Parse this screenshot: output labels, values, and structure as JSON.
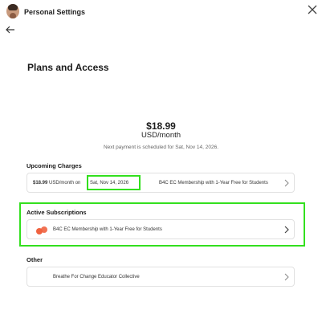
{
  "header": {
    "title": "Personal Settings"
  },
  "page": {
    "heading": "Plans and Access"
  },
  "plan": {
    "price": "$18.99",
    "unit": "USD/month",
    "next_payment": "Next payment is scheduled for Sat, Nov 14, 2026."
  },
  "upcoming": {
    "label": "Upcoming Charges",
    "amount": "$18.99",
    "amount_suffix": "USD/month on",
    "date": "Sat, Nov 14, 2026",
    "plan_name": "B4C EC Membership with 1-Year Free for Students"
  },
  "active": {
    "label": "Active Subscriptions",
    "plan_name": "B4C EC Membership with 1-Year Free for Students"
  },
  "other": {
    "label": "Other",
    "item": "Breathe For Change Educator Collective"
  },
  "colors": {
    "highlight": "#33e01e",
    "accent": "#f0623f",
    "border": "#e1e1e1"
  },
  "icons": {
    "back": "arrow-left-icon",
    "close": "close-icon",
    "chevron": "chevron-right-icon",
    "logo": "b4c-logo-icon"
  }
}
